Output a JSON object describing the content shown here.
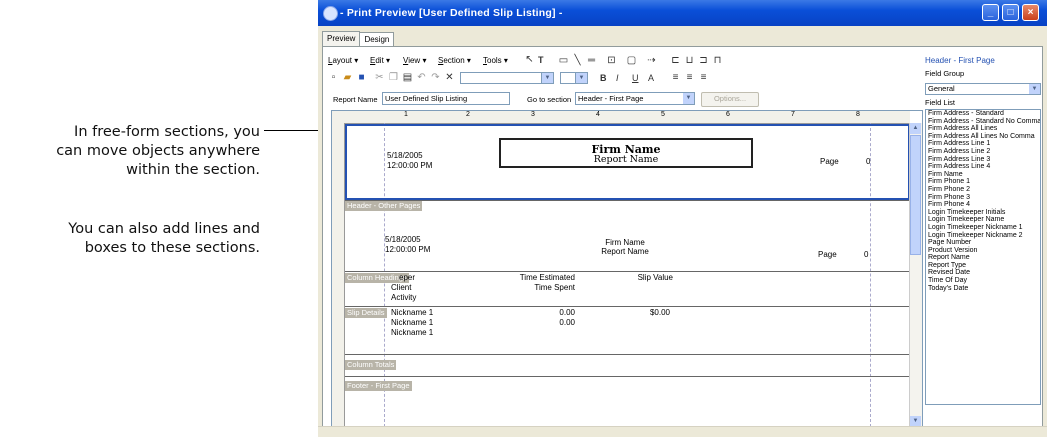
{
  "annotations": {
    "free_form": [
      "In free-form sections, you",
      "can move objects anywhere",
      "within the section."
    ],
    "lines_boxes": [
      "You can also add lines and",
      "boxes to these sections."
    ]
  },
  "window": {
    "title": "- Print Preview [User Defined Slip Listing] -",
    "tabs": [
      "Preview",
      "Design"
    ],
    "active_tab": "Design"
  },
  "menubar": {
    "items": [
      {
        "label": "Layout",
        "key": "L",
        "rest": "ayout"
      },
      {
        "label": "Edit",
        "key": "E",
        "rest": "dit"
      },
      {
        "label": "View",
        "key": "V",
        "rest": "iew"
      },
      {
        "label": "Section",
        "key": "S",
        "rest": "ection"
      },
      {
        "label": "Tools",
        "key": "T",
        "rest": "ools"
      }
    ],
    "tools_text": "T"
  },
  "toolbar": {
    "bold": "B",
    "italic": "I",
    "underline": "U",
    "font_color": "A"
  },
  "report": {
    "name_label": "Report Name",
    "name_value": "User Defined Slip Listing",
    "goto_label": "Go to section",
    "goto_value": "Header - First Page",
    "options_label": "Options..."
  },
  "ruler": {
    "marks": [
      "1",
      "2",
      "3",
      "4",
      "5",
      "6",
      "7",
      "8"
    ]
  },
  "sections": {
    "header_first": {
      "date": "5/18/2005",
      "time": "12:00:00 PM",
      "firm": "Firm Name",
      "report": "Report Name",
      "page_label": "Page",
      "page_value": "0"
    },
    "header_other": {
      "label": "Header - Other Pages",
      "date": "5/18/2005",
      "time": "12:00:00 PM",
      "firm": "Firm Name",
      "report": "Report Name",
      "page_label": "Page",
      "page_value": "0"
    },
    "column_headings": {
      "label": "Column Headings",
      "col1_partial": "eper",
      "col1_line2": "Client",
      "col1_line3": "Activity",
      "col2_line1": "Time Estimated",
      "col2_line2": "Time Spent",
      "col3": "Slip Value"
    },
    "slip_details": {
      "label": "Slip Details",
      "nick1": "Nickname 1",
      "nick2": "Nickname 1",
      "nick3": "Nickname 1",
      "v1": "0.00",
      "v2": "0.00",
      "amount": "$0.00"
    },
    "column_totals": {
      "label": "Column Totals"
    },
    "footer_first": {
      "label": "Footer - First Page"
    }
  },
  "panel": {
    "title": "Header - First Page",
    "field_group_label": "Field Group",
    "field_group_value": "General",
    "field_list_label": "Field List",
    "fields": [
      "Firm Address - Standard",
      "Firm Address - Standard No Comma",
      "Firm Address All Lines",
      "Firm Address All Lines No Comma",
      "Firm Address Line 1",
      "Firm Address Line 2",
      "Firm Address Line 3",
      "Firm Address Line 4",
      "Firm Name",
      "Firm Phone 1",
      "Firm Phone 2",
      "Firm Phone 3",
      "Firm Phone 4",
      "Login Timekeeper Initials",
      "Login Timekeeper Name",
      "Login Timekeeper Nickname 1",
      "Login Timekeeper Nickname 2",
      "Page Number",
      "Product Version",
      "Report Name",
      "Report Type",
      "Revised Date",
      "Time Of Day",
      "Today's Date"
    ]
  }
}
